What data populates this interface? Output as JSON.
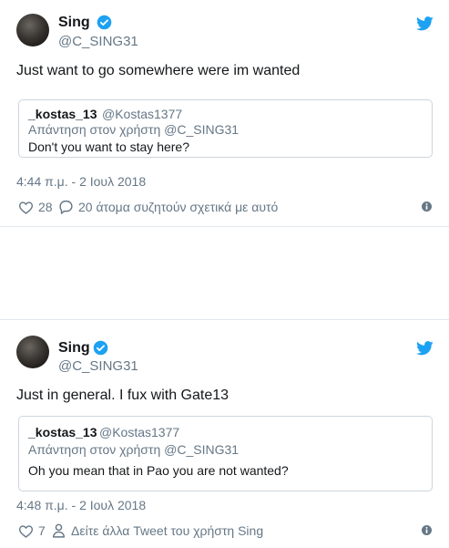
{
  "colors": {
    "brand": "#1da1f2",
    "text": "#14171a",
    "muted": "#657786",
    "border": "#e1e8ed"
  },
  "tweets": [
    {
      "author_name": "Sing",
      "author_handle": "@C_SING31",
      "text": "Just want to go somewhere were im wanted",
      "quote": {
        "name": "_kostas_13",
        "handle": "@Kostas1377",
        "reply_to": "Απάντηση στον χρήστη @C_SING31",
        "text": "Don't you want to stay here?"
      },
      "timestamp": "4:44 π.μ. - 2 Ιουλ 2018",
      "likes": "28",
      "second_action": "20 άτομα συζητούν σχετικά με αυτό",
      "second_action_icon": "comment-icon"
    },
    {
      "author_name": "Sing",
      "author_handle": "@C_SING31",
      "text": "Just in general. I fux with Gate13",
      "quote": {
        "name": "_kostas_13",
        "handle": "@Kostas1377",
        "reply_to": "Απάντηση στον χρήστη @C_SING31",
        "text": "Oh you mean that in Pao you are not wanted?"
      },
      "timestamp": "4:48 π.μ. - 2 Ιουλ 2018",
      "likes": "7",
      "second_action": "Δείτε άλλα Tweet του χρήστη Sing",
      "second_action_icon": "person-icon"
    }
  ]
}
